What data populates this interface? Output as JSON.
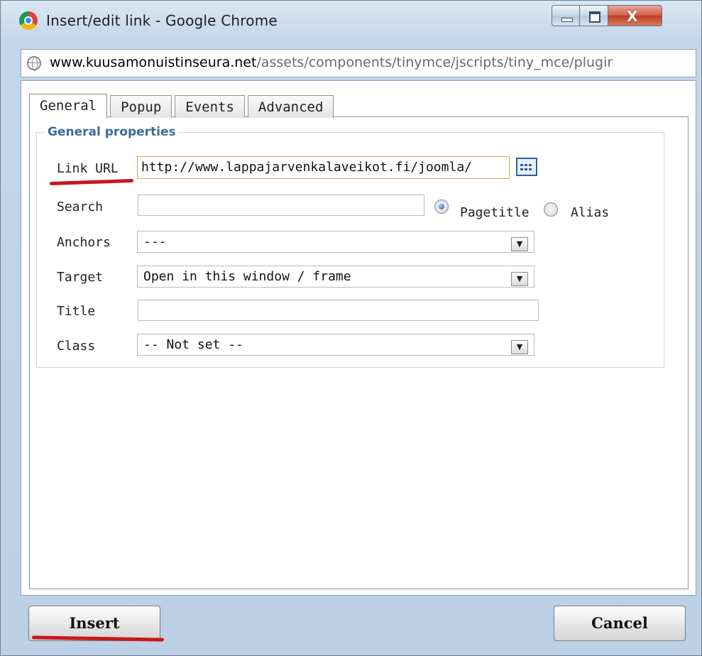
{
  "window": {
    "title": "Insert/edit link - Google Chrome",
    "controls": {
      "minimize": "–",
      "maximize": "□",
      "close": "X"
    }
  },
  "address_bar": {
    "host": "www.kuusamonuistinseura.net",
    "path": "/assets/components/tinymce/jscripts/tiny_mce/plugir"
  },
  "tabs": [
    {
      "label": "General",
      "active": true
    },
    {
      "label": "Popup",
      "active": false
    },
    {
      "label": "Events",
      "active": false
    },
    {
      "label": "Advanced",
      "active": false
    }
  ],
  "general": {
    "legend": "General properties",
    "link_url": {
      "label": "Link URL",
      "value": "http://www.lappajarvenkalaveikot.fi/joomla/"
    },
    "search": {
      "label": "Search",
      "value": ""
    },
    "search_mode": {
      "options": [
        "Pagetitle",
        "Alias"
      ],
      "selected": "Pagetitle"
    },
    "anchors": {
      "label": "Anchors",
      "value": "---"
    },
    "target": {
      "label": "Target",
      "value": "Open in this window / frame"
    },
    "title": {
      "label": "Title",
      "value": ""
    },
    "class": {
      "label": "Class",
      "value": "-- Not set --"
    }
  },
  "buttons": {
    "insert": "Insert",
    "cancel": "Cancel"
  },
  "colors": {
    "annotation_red": "#c8171c",
    "legend_blue": "#3d6a99",
    "url_field_border": "#e0a54b"
  },
  "icons": [
    "chrome-logo-icon",
    "globe-icon",
    "browse-icon",
    "select-arrow-icon"
  ]
}
